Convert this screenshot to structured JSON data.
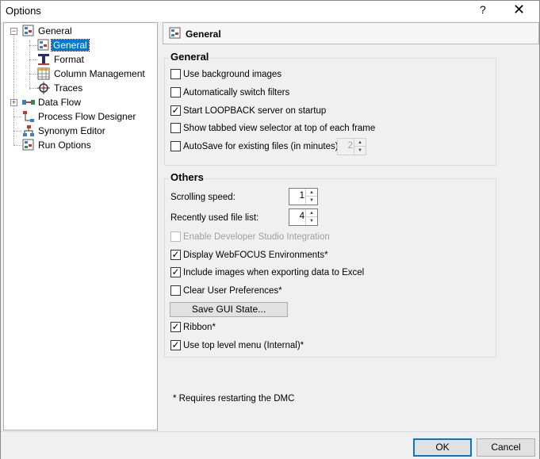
{
  "window": {
    "title": "Options",
    "help": "?",
    "close": "✕"
  },
  "tree": {
    "items": [
      {
        "label": "General",
        "expander": "−",
        "icon": "settings-icon"
      },
      {
        "label": "General",
        "icon": "settings-icon",
        "selected": true
      },
      {
        "label": "Format",
        "icon": "format-icon"
      },
      {
        "label": "Column Management",
        "icon": "table-icon"
      },
      {
        "label": "Traces",
        "icon": "traces-icon"
      },
      {
        "label": "Data Flow",
        "expander": "+",
        "icon": "data-flow-icon"
      },
      {
        "label": "Process Flow Designer",
        "icon": "process-flow-icon"
      },
      {
        "label": "Synonym Editor",
        "icon": "synonym-editor-icon"
      },
      {
        "label": "Run Options",
        "icon": "run-options-icon"
      }
    ]
  },
  "header": {
    "title": "General"
  },
  "general_group": {
    "legend": "General",
    "options": [
      {
        "label": "Use background images",
        "checked": false
      },
      {
        "label": "Automatically switch filters",
        "checked": false
      },
      {
        "label": "Start LOOPBACK server on startup",
        "checked": true
      },
      {
        "label": "Show tabbed view selector at top of each frame",
        "checked": false
      },
      {
        "label": "AutoSave for existing files (in minutes):",
        "checked": false
      }
    ],
    "autosave_value": "2"
  },
  "others_group": {
    "legend": "Others",
    "scrolling_speed_label": "Scrolling speed:",
    "scrolling_speed_value": "1",
    "recent_files_label": "Recently used file list:",
    "recent_files_value": "4",
    "options": [
      {
        "label": "Enable Developer Studio Integration",
        "checked": false,
        "disabled": true
      },
      {
        "label": "Display WebFOCUS Environments*",
        "checked": true
      },
      {
        "label": "Include images when exporting data to Excel",
        "checked": true
      },
      {
        "label": "Clear User Preferences*",
        "checked": false
      }
    ],
    "save_gui_label": "Save GUI State...",
    "options2": [
      {
        "label": "Ribbon*",
        "checked": true
      },
      {
        "label": "Use top level menu (Internal)*",
        "checked": true
      }
    ]
  },
  "note": "* Requires restarting the DMC",
  "footer": {
    "ok": "OK",
    "cancel": "Cancel"
  },
  "glyphs": {
    "check": "✓",
    "up": "▲",
    "down": "▼"
  }
}
